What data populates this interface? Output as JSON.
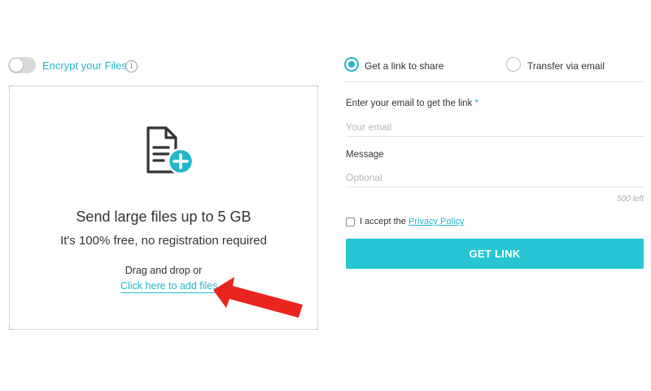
{
  "encrypt": {
    "label": "Encrypt your Files",
    "enabled": false,
    "info_icon": "i"
  },
  "dropzone": {
    "title": "Send large files up to 5 GB",
    "subtitle": "It's 100% free, no registration required",
    "drag_text": "Drag and drop or",
    "add_files_link": "Click here to add files",
    "icon": "file-add-icon"
  },
  "share_options": [
    {
      "label": "Get a link to share",
      "selected": true
    },
    {
      "label": "Transfer via email",
      "selected": false
    }
  ],
  "form": {
    "email_label": "Enter your email to get the link",
    "required_marker": "*",
    "email_placeholder": "Your email",
    "email_value": "",
    "message_label": "Message",
    "message_placeholder": "Optional",
    "message_value": "",
    "chars_left": "500 left",
    "accept_prefix": "I accept the",
    "privacy_link": "Privacy Policy",
    "accepted": false,
    "submit_label": "GET LINK"
  },
  "colors": {
    "accent": "#22b8c8",
    "button": "#26c6d4",
    "arrow": "#e8251f"
  }
}
